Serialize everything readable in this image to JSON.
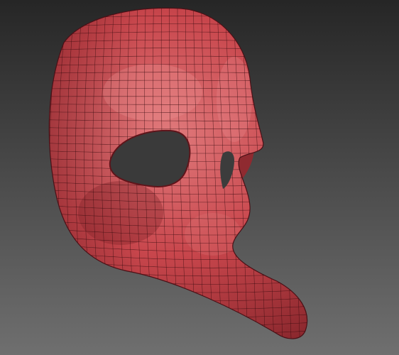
{
  "scene": {
    "subject": "mask-model",
    "render_style": "wireframe-on-shaded",
    "colors": {
      "background_top": "#262626",
      "background_bottom": "#6f6f6f",
      "mask_base": "#c8464c",
      "mask_highlight": "#e07a7c",
      "mask_shadow": "#7a1f25",
      "wire": "#3a0c10"
    }
  }
}
